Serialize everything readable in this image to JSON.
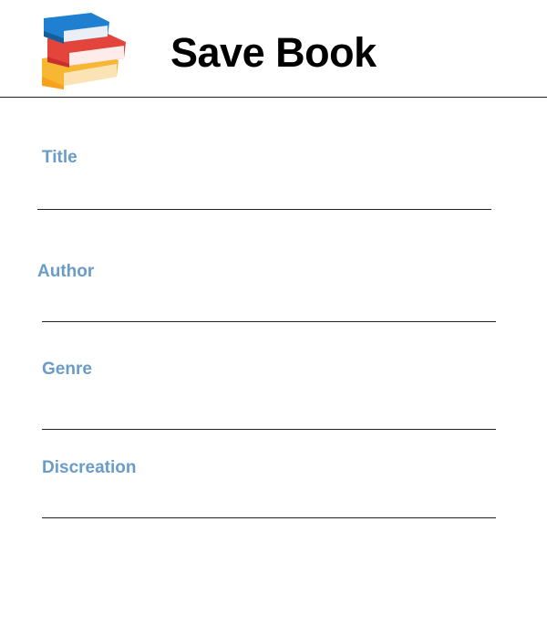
{
  "header": {
    "title": "Save Book",
    "logo_icon": "books-stack-icon"
  },
  "form": {
    "fields": [
      {
        "label": "Title",
        "value": ""
      },
      {
        "label": "Author",
        "value": ""
      },
      {
        "label": "Genre",
        "value": ""
      },
      {
        "label": "Discreation",
        "value": ""
      }
    ]
  },
  "colors": {
    "label": "#6a9cc7",
    "title": "#000000",
    "underline": "#222222",
    "book_blue": "#1f7fd1",
    "book_red": "#e3443c",
    "book_yellow": "#f7b733"
  }
}
